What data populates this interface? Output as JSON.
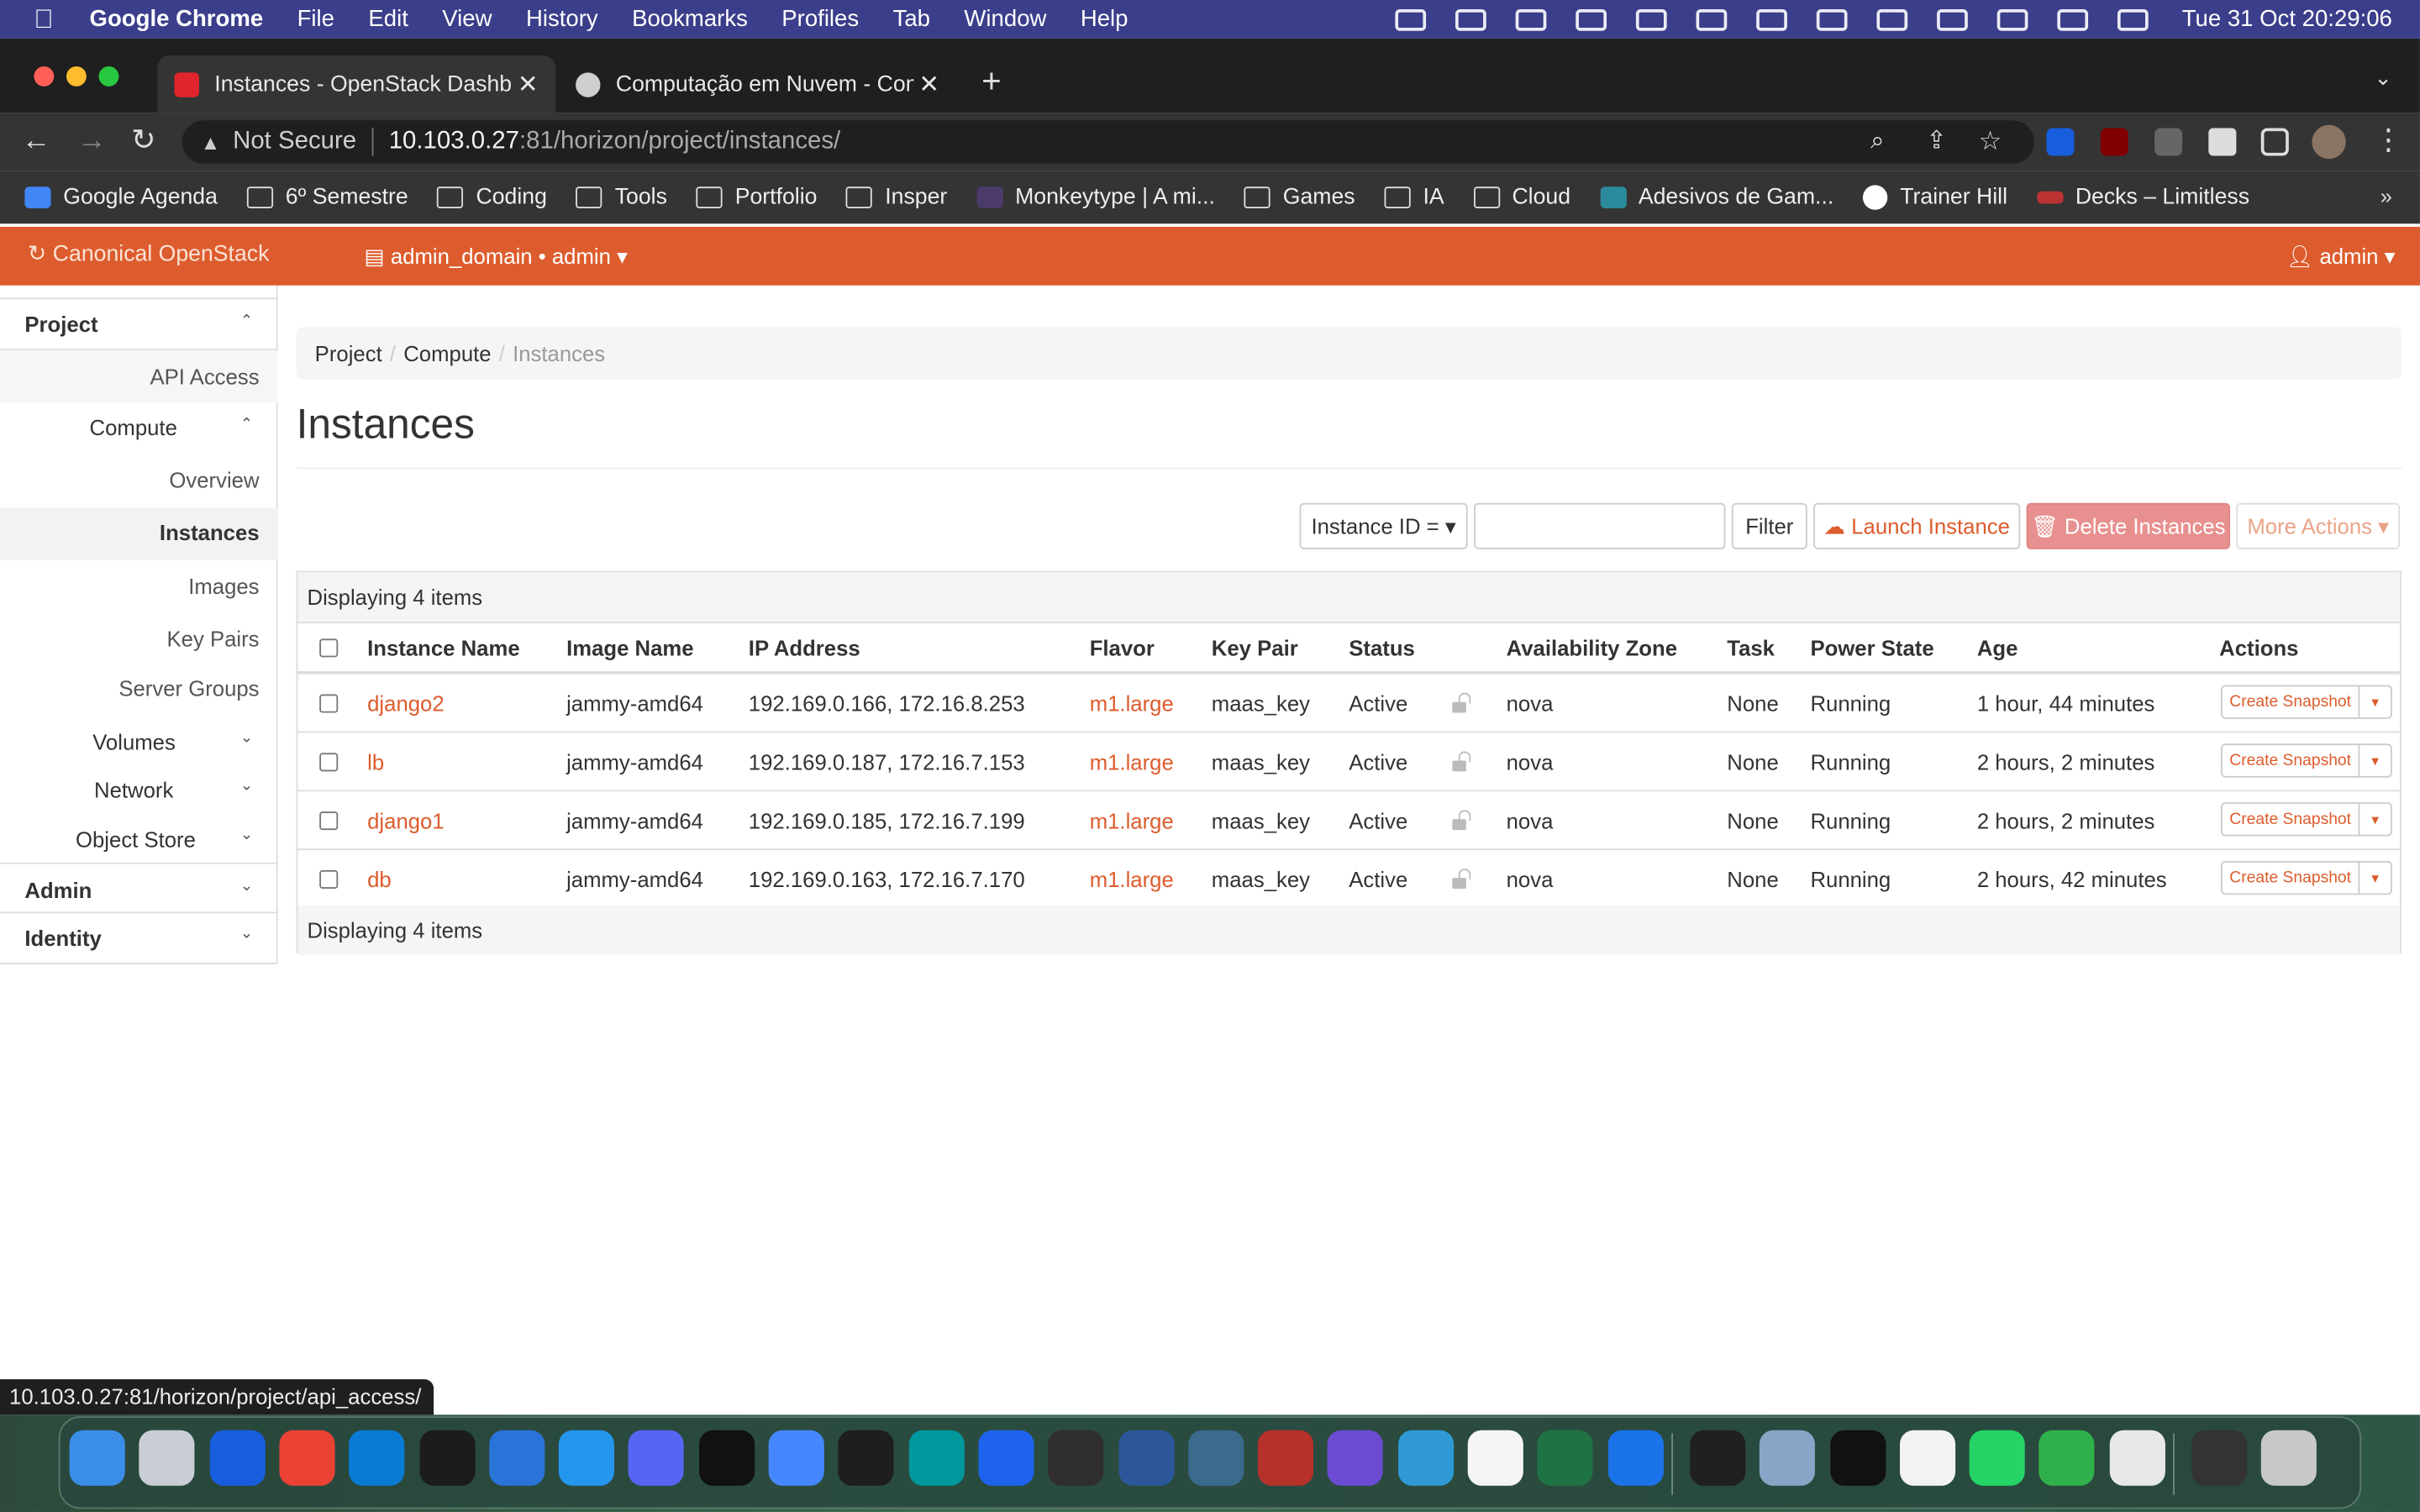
{
  "menubar": {
    "app_name": "Google Chrome",
    "items": [
      "File",
      "Edit",
      "View",
      "History",
      "Bookmarks",
      "Profiles",
      "Tab",
      "Window",
      "Help"
    ],
    "clock": "Tue 31 Oct  20:29:06"
  },
  "browser": {
    "tabs": [
      {
        "title": "Instances - OpenStack Dashboard",
        "favicon_color": "#e0252d"
      },
      {
        "title": "Computação em Nuvem - Com",
        "favicon_color": "#cfcfcf"
      }
    ],
    "security_label": "Not Secure",
    "url_host": "10.103.0.27",
    "url_rest": ":81/horizon/project/instances/",
    "bookmarks": [
      {
        "label": "Google Agenda",
        "icon": "calendar-icon",
        "color": "#4285f4"
      },
      {
        "label": "6º Semestre",
        "icon": "folder-icon"
      },
      {
        "label": "Coding",
        "icon": "folder-icon"
      },
      {
        "label": "Tools",
        "icon": "folder-icon"
      },
      {
        "label": "Portfolio",
        "icon": "folder-icon"
      },
      {
        "label": "Insper",
        "icon": "folder-icon"
      },
      {
        "label": "Monkeytype | A mi...",
        "icon": "monkeytype-icon",
        "color": "#4b3b6b"
      },
      {
        "label": "Games",
        "icon": "folder-icon"
      },
      {
        "label": "IA",
        "icon": "folder-icon"
      },
      {
        "label": "Cloud",
        "icon": "folder-icon"
      },
      {
        "label": "Adesivos de Gam...",
        "icon": "sticker-icon",
        "color": "#2b8a9b"
      },
      {
        "label": "Trainer Hill",
        "icon": "trainer-icon",
        "color": "#ffffff"
      },
      {
        "label": "Decks – Limitless",
        "icon": "limitless-icon",
        "color": "#b33"
      }
    ],
    "bookmarks_more": "»",
    "status_url": "10.103.0.27:81/horizon/project/api_access/"
  },
  "header": {
    "brand": "Canonical OpenStack",
    "project_selector": "admin_domain • admin",
    "user_menu": "admin",
    "accent": "#dd5c2d"
  },
  "sidebar": {
    "project": "Project",
    "api_access": "API Access",
    "compute": "Compute",
    "overview": "Overview",
    "instances": "Instances",
    "images": "Images",
    "key_pairs": "Key Pairs",
    "server_groups": "Server Groups",
    "volumes": "Volumes",
    "network": "Network",
    "object_store": "Object Store",
    "admin": "Admin",
    "identity": "Identity"
  },
  "breadcrumb": [
    "Project",
    "Compute",
    "Instances"
  ],
  "page_title": "Instances",
  "toolbar": {
    "filter_field": "Instance ID =",
    "filter_value": "",
    "filter_button": "Filter",
    "launch_button": "Launch Instance",
    "delete_button": "Delete Instances",
    "more_actions": "More Actions"
  },
  "table": {
    "caption": "Displaying 4 items",
    "columns": [
      "Instance Name",
      "Image Name",
      "IP Address",
      "Flavor",
      "Key Pair",
      "Status",
      "Availability Zone",
      "Task",
      "Power State",
      "Age",
      "Actions"
    ],
    "rows": [
      {
        "name": "django2",
        "image": "jammy-amd64",
        "ip": "192.169.0.166, 172.16.8.253",
        "flavor": "m1.large",
        "key_pair": "maas_key",
        "status": "Active",
        "zone": "nova",
        "task": "None",
        "power": "Running",
        "age": "1 hour, 44 minutes",
        "action": "Create Snapshot"
      },
      {
        "name": "lb",
        "image": "jammy-amd64",
        "ip": "192.169.0.187, 172.16.7.153",
        "flavor": "m1.large",
        "key_pair": "maas_key",
        "status": "Active",
        "zone": "nova",
        "task": "None",
        "power": "Running",
        "age": "2 hours, 2 minutes",
        "action": "Create Snapshot"
      },
      {
        "name": "django1",
        "image": "jammy-amd64",
        "ip": "192.169.0.185, 172.16.7.199",
        "flavor": "m1.large",
        "key_pair": "maas_key",
        "status": "Active",
        "zone": "nova",
        "task": "None",
        "power": "Running",
        "age": "2 hours, 2 minutes",
        "action": "Create Snapshot"
      },
      {
        "name": "db",
        "image": "jammy-amd64",
        "ip": "192.169.0.163, 172.16.7.170",
        "flavor": "m1.large",
        "key_pair": "maas_key",
        "status": "Active",
        "zone": "nova",
        "task": "None",
        "power": "Running",
        "age": "2 hours, 42 minutes",
        "action": "Create Snapshot"
      }
    ],
    "footer": "Displaying 4 items"
  },
  "dock": [
    {
      "name": "finder-icon",
      "color": "#3b8ee8"
    },
    {
      "name": "launchpad-icon",
      "color": "#c9ced6"
    },
    {
      "name": "bitwarden-icon",
      "color": "#175ddc"
    },
    {
      "name": "chrome-icon",
      "color": "#e94235"
    },
    {
      "name": "vscode-icon",
      "color": "#0a7bd4"
    },
    {
      "name": "terminal-icon",
      "color": "#1c1c1c"
    },
    {
      "name": "xcode-icon",
      "color": "#2a73d9"
    },
    {
      "name": "docker-icon",
      "color": "#2496ed"
    },
    {
      "name": "discord-icon",
      "color": "#5865f2"
    },
    {
      "name": "logitech-icon",
      "color": "#111111"
    },
    {
      "name": "nordvpn-icon",
      "color": "#4687ff"
    },
    {
      "name": "figma-icon",
      "color": "#1e1e1e"
    },
    {
      "name": "arduino-icon",
      "color": "#00979d"
    },
    {
      "name": "docker-desktop-icon",
      "color": "#1d63ed"
    },
    {
      "name": "obs-icon",
      "color": "#302e31"
    },
    {
      "name": "word-icon",
      "color": "#2b579a"
    },
    {
      "name": "mysql-workbench-icon",
      "color": "#3a6a8c"
    },
    {
      "name": "robot-icon",
      "color": "#b5312a"
    },
    {
      "name": "beeper-icon",
      "color": "#6a4bd1"
    },
    {
      "name": "dolphin-icon",
      "color": "#2f9ad6"
    },
    {
      "name": "clock-icon",
      "color": "#f5f5f5"
    },
    {
      "name": "excel-icon",
      "color": "#1f7244"
    },
    {
      "name": "malwarebytes-icon",
      "color": "#1a73e8"
    },
    {
      "name": "epic-games-icon",
      "color": "#202020"
    },
    {
      "name": "preview-icon",
      "color": "#8aa4c8"
    },
    {
      "name": "terminal2-icon",
      "color": "#111111"
    },
    {
      "name": "textedit-icon",
      "color": "#f2f2f2"
    },
    {
      "name": "whatsapp-icon",
      "color": "#25d366"
    },
    {
      "name": "numbers-icon",
      "color": "#30b04b"
    },
    {
      "name": "documents-icon",
      "color": "#e8e8e8"
    },
    {
      "name": "screen-icon",
      "color": "#333333"
    },
    {
      "name": "trash-icon",
      "color": "#c8c8c8"
    }
  ]
}
